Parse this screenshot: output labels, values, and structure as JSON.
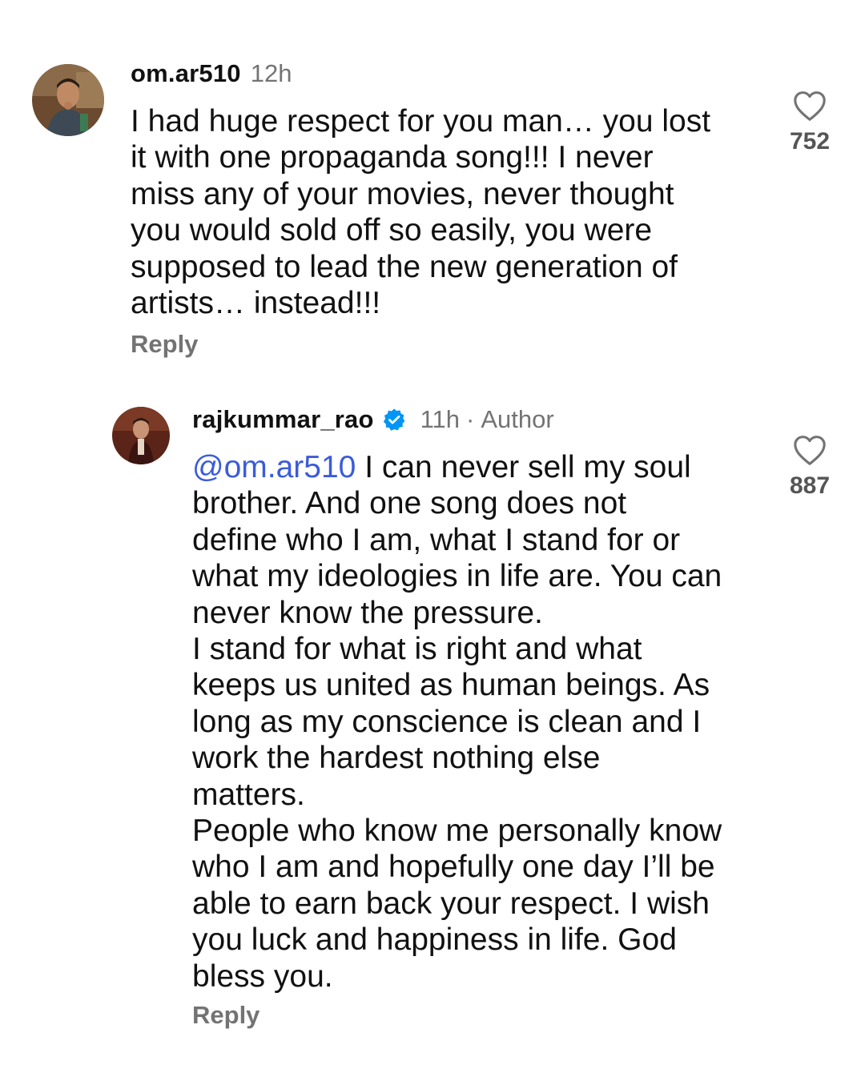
{
  "comments": [
    {
      "username": "om.ar510",
      "time": "12h",
      "text": "I had huge respect for you man… you lost\nit with one propaganda song!!! I never\nmiss any of your movies, never thought\nyou would sold off so easily, you were\nsupposed to lead the new generation of\nartists… instead!!!",
      "reply_label": "Reply",
      "likes": "752",
      "icon": "heart-outline-icon"
    },
    {
      "username": "rajkummar_rao",
      "verified": true,
      "time": "11h",
      "separator": "·",
      "author_label": "Author",
      "mention": "@om.ar510",
      "text": " I can never sell my soul\nbrother. And one song does not\ndefine who I am, what I stand for or\nwhat my ideologies in life are. You can\nnever know the pressure.\nI stand for what is right and what\nkeeps us united as human beings. As\nlong as my conscience is clean and I\nwork the hardest nothing else\nmatters.\nPeople who know me personally know\nwho I am  and hopefully one day I’ll be\nable to earn back your respect. I wish\nyou luck and happiness in life. God\nbless you.",
      "reply_label": "Reply",
      "likes": "887",
      "icon": "heart-outline-icon"
    }
  ],
  "colors": {
    "text": "#111111",
    "muted": "#737373",
    "mention": "#3b5bdb",
    "verified": "#0095f6"
  }
}
